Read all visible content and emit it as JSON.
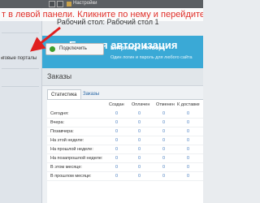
{
  "caption": "т в левой панели. Кликните по нему и перейдите в \"Про",
  "topbar": {
    "label": "Настройки"
  },
  "leftpanel": {
    "item": "товые порталы"
  },
  "desktop": {
    "title": "Рабочий стол: Рабочий стол 1"
  },
  "banner": {
    "title": "Единая авторизация",
    "connect_button": "Подключить",
    "network_name": "Битрикс24.Нетворк",
    "network_desc": "Один логин и пароль для любого сайта"
  },
  "orders": {
    "title": "Заказы",
    "tabs": [
      "Статистика",
      "Заказы"
    ],
    "columns": [
      "Создан",
      "Оплачен",
      "Отменен",
      "К доставке"
    ],
    "rows": [
      {
        "label": "Сегодня:",
        "values": [
          "0",
          "0",
          "0",
          "0"
        ]
      },
      {
        "label": "Вчера:",
        "values": [
          "0",
          "0",
          "0",
          "0"
        ]
      },
      {
        "label": "Позавчера:",
        "values": [
          "0",
          "0",
          "0",
          "0"
        ]
      },
      {
        "label": "На этой неделе:",
        "values": [
          "0",
          "0",
          "0",
          "0"
        ]
      },
      {
        "label": "На прошлой неделе:",
        "values": [
          "0",
          "0",
          "0",
          "0"
        ]
      },
      {
        "label": "На позапрошлой неделе:",
        "values": [
          "0",
          "0",
          "0",
          "0"
        ]
      },
      {
        "label": "В этом месяце:",
        "values": [
          "0",
          "0",
          "0",
          "0"
        ]
      },
      {
        "label": "В прошлом месяце:",
        "values": [
          "0",
          "0",
          "0",
          "0"
        ]
      }
    ]
  },
  "colors": {
    "banner": "#3aa9d6",
    "caption_text": "#e0302a",
    "arrow": "#e02020"
  }
}
